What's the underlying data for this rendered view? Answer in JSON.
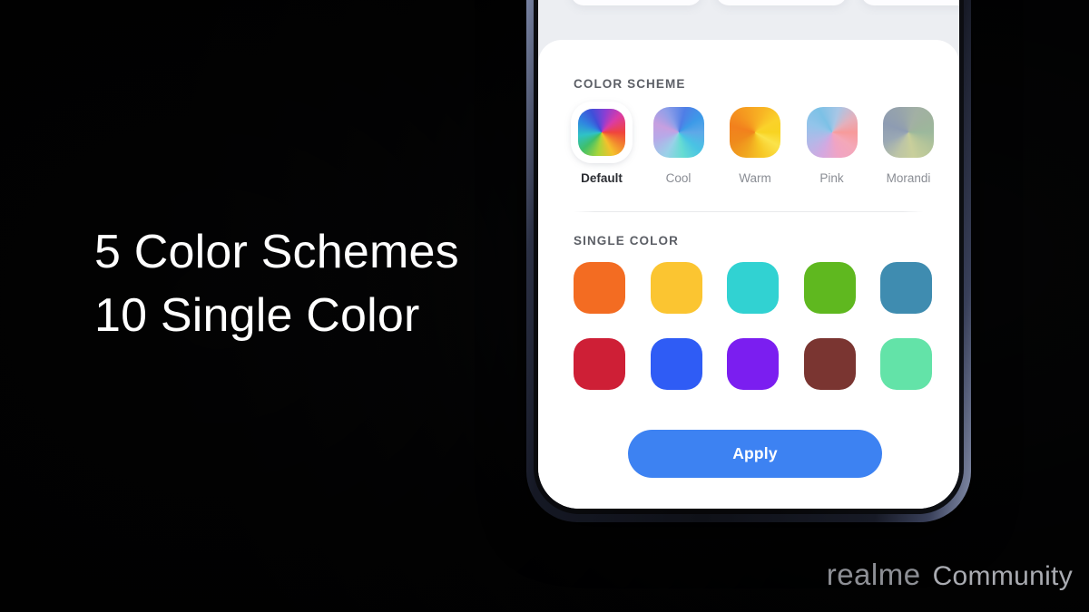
{
  "headline": {
    "line1": "5 Color Schemes",
    "line2": "10 Single Color"
  },
  "watermark": {
    "brand": "realme",
    "suffix": "Community"
  },
  "phone_ui": {
    "color_scheme": {
      "label": "COLOR SCHEME",
      "items": [
        {
          "name": "Default",
          "selected": true,
          "style": "g-default"
        },
        {
          "name": "Cool",
          "selected": false,
          "style": "g-cool"
        },
        {
          "name": "Warm",
          "selected": false,
          "style": "g-warm"
        },
        {
          "name": "Pink",
          "selected": false,
          "style": "g-pink"
        },
        {
          "name": "Morandi",
          "selected": false,
          "style": "g-morandi"
        }
      ]
    },
    "single_color": {
      "label": "SINGLE COLOR",
      "swatches": [
        {
          "name": "orange",
          "hex": "#f36c22"
        },
        {
          "name": "amber",
          "hex": "#fbc531"
        },
        {
          "name": "turquoise",
          "hex": "#31d2d2"
        },
        {
          "name": "green",
          "hex": "#5fb81f"
        },
        {
          "name": "steel-blue",
          "hex": "#3f8cb0"
        },
        {
          "name": "crimson",
          "hex": "#ce1f36"
        },
        {
          "name": "blue",
          "hex": "#2f5cf5"
        },
        {
          "name": "violet",
          "hex": "#7b1ef0"
        },
        {
          "name": "maroon",
          "hex": "#7a3531"
        },
        {
          "name": "mint",
          "hex": "#63e3a8"
        }
      ]
    },
    "apply_label": "Apply",
    "accent_color": "#3d82f2"
  }
}
